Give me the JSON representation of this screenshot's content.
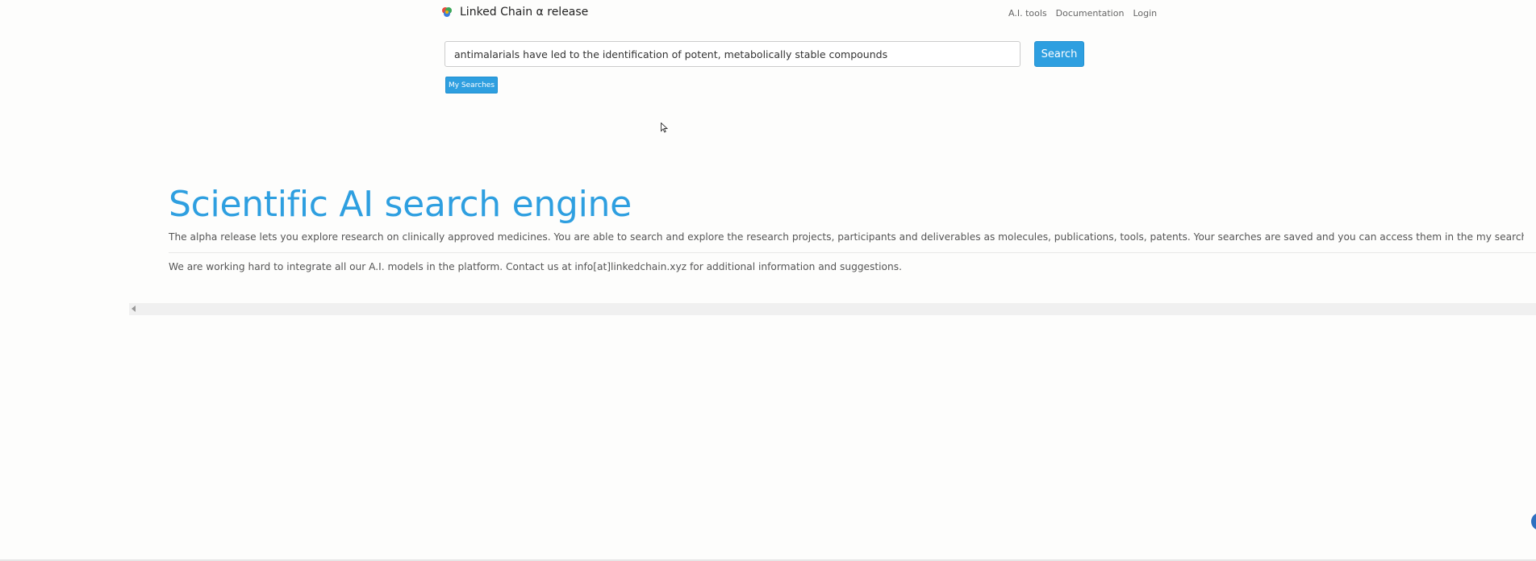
{
  "brand": {
    "name": "Linked Chain α release",
    "logo_icon": "linked-chain-logo-icon"
  },
  "nav": {
    "links": [
      "A.I. tools",
      "Documentation",
      "Login"
    ]
  },
  "search": {
    "value": "antimalarials have led to the identification of potent, metabolically stable compounds",
    "button_label": "Search",
    "my_searches_label": "My Searches"
  },
  "hero": {
    "title": "Scientific AI search engine",
    "description": "The alpha release lets you explore research on clinically approved medicines. You are able to search and explore the research projects, participants and deliverables as molecules, publications, tools, patents. Your searches are saved and you can access them in the my searches section.",
    "contact": "We are working hard to integrate all our A.I. models in the platform. Contact us at info[at]linkedchain.xyz for additional information and suggestions."
  },
  "colors": {
    "accent": "#2e9fe0",
    "text": "#555555",
    "background": "#fdfdfc"
  }
}
